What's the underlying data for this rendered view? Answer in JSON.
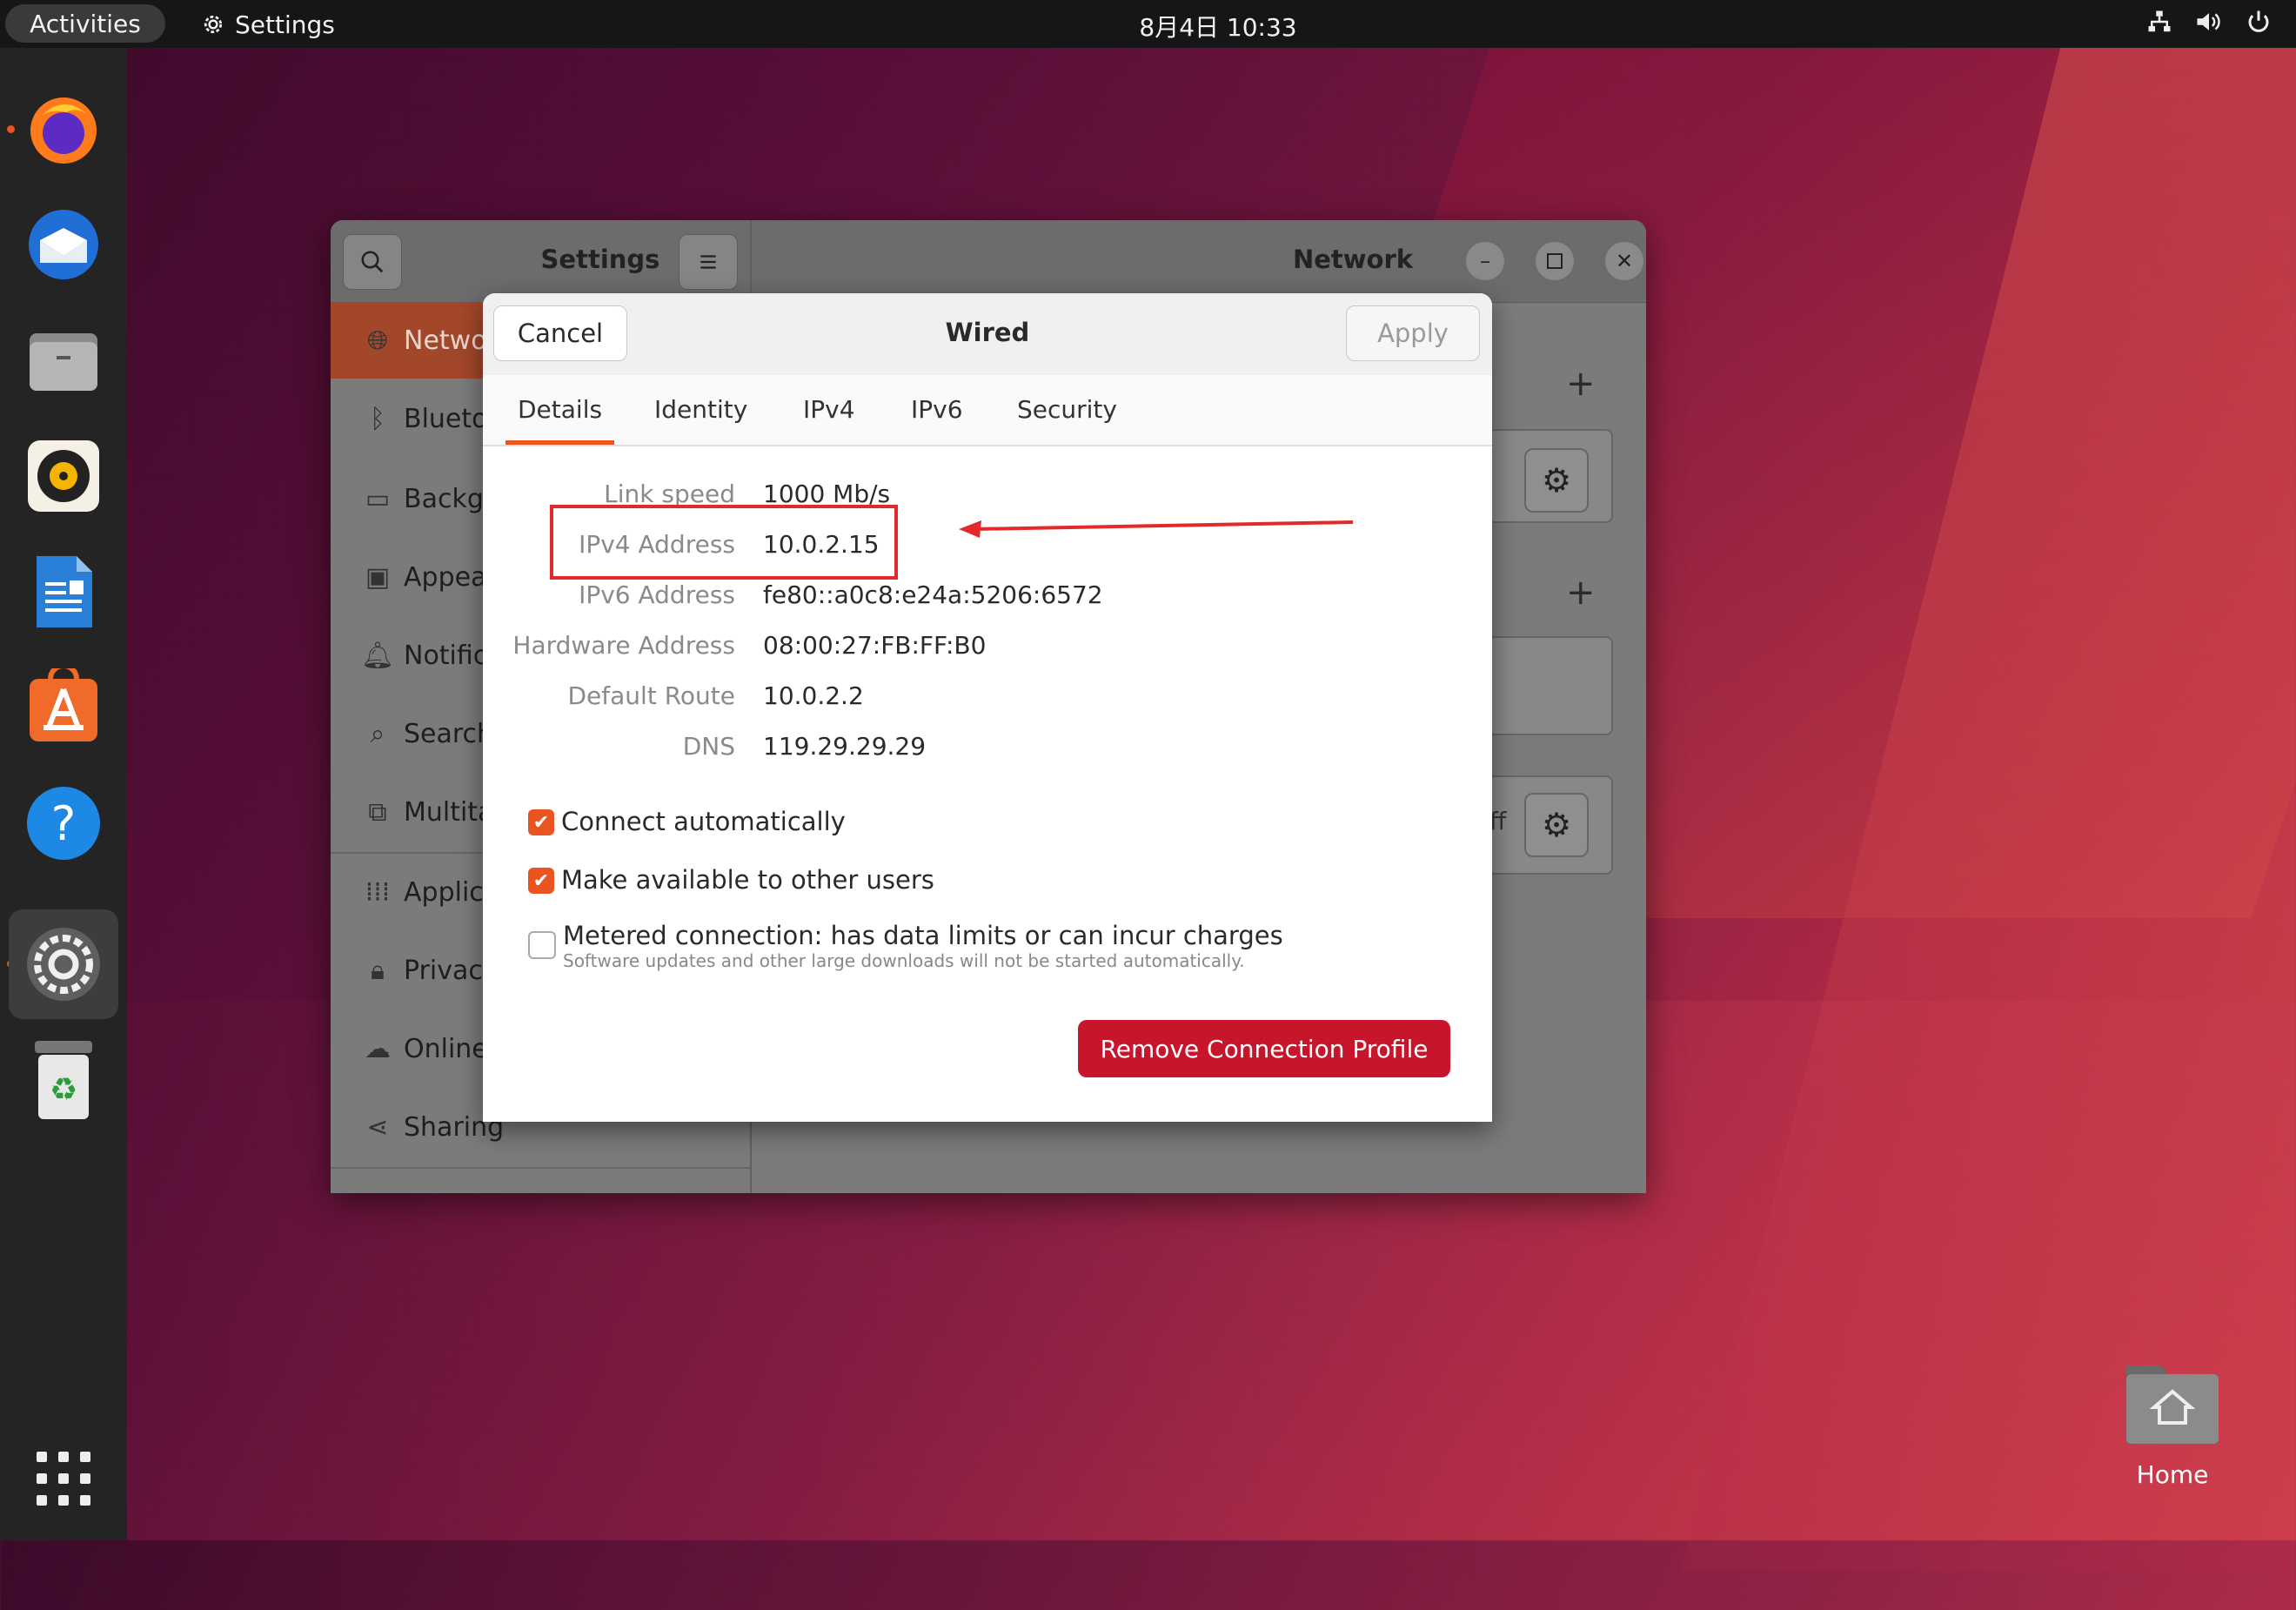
{
  "topbar": {
    "activities": "Activities",
    "app_name": "Settings",
    "clock": "8月4日  10:33"
  },
  "dock": {
    "items": [
      "firefox",
      "thunderbird",
      "files",
      "rhythmbox",
      "libreoffice-writer",
      "ubuntu-software",
      "help",
      "settings",
      "trash"
    ]
  },
  "settings": {
    "title_left": "Settings",
    "title_right": "Network",
    "sidebar": [
      {
        "label": "Netwo",
        "icon": "globe-icon"
      },
      {
        "label": "Blueto",
        "icon": "bluetooth-icon"
      },
      {
        "label": "Backgr",
        "icon": "background-icon"
      },
      {
        "label": "Appear",
        "icon": "appearance-icon"
      },
      {
        "label": "Notific",
        "icon": "bell-icon"
      },
      {
        "label": "Search",
        "icon": "search-icon"
      },
      {
        "label": "Multita",
        "icon": "multitasking-icon"
      },
      {
        "label": "Applica",
        "icon": "apps-grid-icon"
      },
      {
        "label": "Privacy",
        "icon": "lock-icon"
      },
      {
        "label": "Online",
        "icon": "cloud-icon"
      },
      {
        "label": "Sharing",
        "icon": "share-icon"
      }
    ],
    "partial_text_off": "ff"
  },
  "dialog": {
    "title": "Wired",
    "cancel": "Cancel",
    "apply": "Apply",
    "tabs": [
      "Details",
      "Identity",
      "IPv4",
      "IPv6",
      "Security"
    ],
    "details": [
      {
        "label": "Link speed",
        "value": "1000 Mb/s"
      },
      {
        "label": "IPv4 Address",
        "value": "10.0.2.15"
      },
      {
        "label": "IPv6 Address",
        "value": "fe80::a0c8:e24a:5206:6572"
      },
      {
        "label": "Hardware Address",
        "value": "08:00:27:FB:FF:B0"
      },
      {
        "label": "Default Route",
        "value": "10.0.2.2"
      },
      {
        "label": "DNS",
        "value": "119.29.29.29"
      }
    ],
    "checks": {
      "connect_auto": "Connect automatically",
      "available_users": "Make available to other users",
      "metered": "Metered connection: has data limits or can incur charges",
      "metered_sub": "Software updates and other large downloads will not be started automatically."
    },
    "remove": "Remove Connection Profile"
  },
  "desktop": {
    "home_label": "Home"
  },
  "colors": {
    "accent": "#e95420",
    "danger": "#c7162b",
    "annotation": "#e32a2a"
  }
}
